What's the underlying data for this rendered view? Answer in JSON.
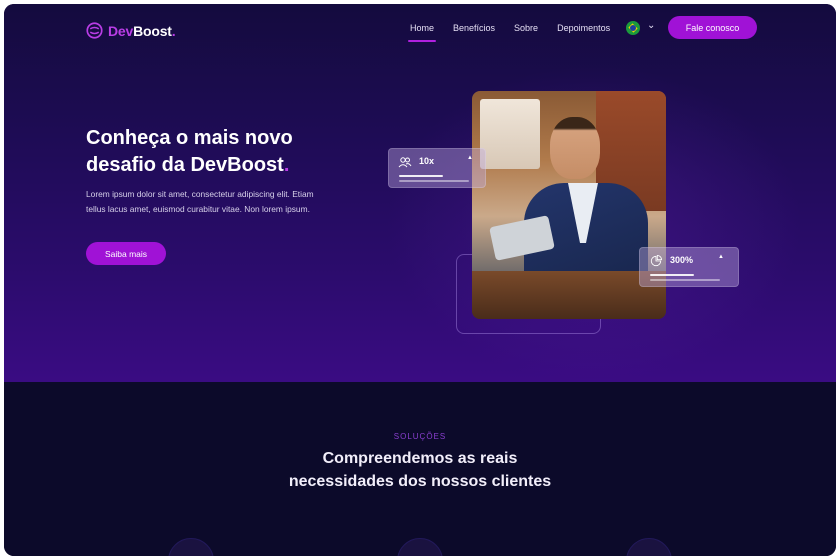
{
  "brand": {
    "prefix": "Dev",
    "suffix": "Boost",
    "dot": ".",
    "accent": "#b93de6"
  },
  "nav": {
    "links": [
      {
        "label": "Home",
        "active": true
      },
      {
        "label": "Benefícios",
        "active": false
      },
      {
        "label": "Sobre",
        "active": false
      },
      {
        "label": "Depoimentos",
        "active": false
      }
    ],
    "language_icon": "brazil-flag-icon",
    "cta": "Fale conosco"
  },
  "hero": {
    "headline_line1": "Conheça o mais novo",
    "headline_line2": "desafio da DevBoost",
    "headline_dot": ".",
    "lead": "Lorem ipsum dolor sit amet, consectetur adipiscing elit. Etiam tellus lacus amet, euismod curabitur vitae. Non lorem ipsum.",
    "button": "Saiba mais"
  },
  "stats": [
    {
      "value": "10x",
      "icon": "users-icon"
    },
    {
      "value": "300%",
      "icon": "pie-chart-icon"
    }
  ],
  "solutions": {
    "eyebrow": "SOLUÇÕES",
    "title_line1": "Compreendemos as reais",
    "title_line2": "necessidades dos nossos clientes"
  },
  "colors": {
    "primary": "#a012d6",
    "hero_bg": "#1e0c55",
    "section_bg": "#0c0a2a"
  }
}
